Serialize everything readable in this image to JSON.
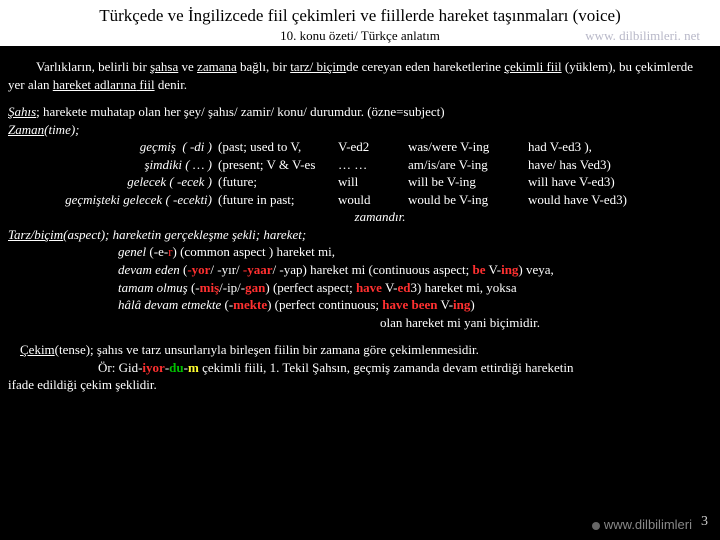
{
  "header": {
    "title": "Türkçede ve İngilizcede fiil çekimleri ve fiillerde hareket taşınmaları (voice)",
    "subtitle": "10. konu özeti/ Türkçe anlatım",
    "url": "www. dilbilimleri. net"
  },
  "intro": {
    "p1a": "Varlıkların, belirli bir ",
    "p1_sahsa": "şahsa",
    "p1_ve": " ve ",
    "p1_zamana": "zamana",
    "p1b": " bağlı, bir ",
    "p1_tarz": "tarz/ biçim",
    "p1c": "de cereyan eden hareketlerine ",
    "p1_cekimli": "çekimli fiil",
    "p1d": " (yüklem), bu çekimlerde yer alan ",
    "p1_hareket": "hareket adlarına",
    "p1_fiil": " fiil",
    "p1e": " denir."
  },
  "sahis": {
    "label": "Şahıs",
    "text": "; harekete muhatap olan her şey/ şahıs/ zamir/ konu/ durumdur. (özne=subject)"
  },
  "zaman": {
    "label": "Zaman",
    "label_suffix": "(time);",
    "rows": [
      {
        "tr": "geçmiş",
        "suffix": "( -di )",
        "en": "(past;",
        "f1": "used to V,",
        "f2": "V-ed2",
        "f3": "was/were V-ing",
        "f4": "had V-ed3 ),"
      },
      {
        "tr": "şimdiki",
        "suffix": "( … )",
        "en": "(present;",
        "f1": "V & V-es",
        "f2": "… …",
        "f3": "am/is/are V-ing",
        "f4": "have/ has Ved3)"
      },
      {
        "tr": "gelecek",
        "suffix": "( -ecek )",
        "en": "(future;",
        "f1": "",
        "f2": "will",
        "f3": "will be V-ing",
        "f4": "will have V-ed3)"
      },
      {
        "tr": "geçmişteki gelecek",
        "suffix": "( -ecekti)",
        "en": "(future in past;",
        "f1": "",
        "f2": "would",
        "f3": "would be V-ing",
        "f4": "would have V-ed3)"
      }
    ],
    "closing": "zamandır."
  },
  "tarz": {
    "label": "Tarz/biçim",
    "label_suffix": "(aspect); hareketin gerçekleşme şekli; hareket;",
    "lines": {
      "genel_a": "genel",
      "genel_b": " (-e-",
      "genel_r": "r",
      "genel_c": ") (common aspect ) hareket mi,",
      "devam_a": "devam eden",
      "devam_b": " (",
      "devam_y1": "-yor",
      "devam_s1": "/ -yır/ ",
      "devam_y2": "-yaar",
      "devam_s2": "/ -yap) hareket mi (continuous aspect; ",
      "devam_be": "be",
      "devam_v": " V-",
      "devam_ing": "ing",
      "devam_end": ") veya,",
      "tamam_a": "tamam olmuş",
      "tamam_b": " (-",
      "tamam_m": "miş",
      "tamam_s1": "/-ip/-",
      "tamam_g": "gan",
      "tamam_s2": ") (perfect aspect; ",
      "tamam_have": "have",
      "tamam_v": " V-",
      "tamam_ed": "ed",
      "tamam_end": "3) hareket mi, yoksa",
      "hala_a": "hâlâ devam etmekte",
      "hala_b": " (-",
      "hala_m": "mekte",
      "hala_s": ") (perfect continuous; ",
      "hala_hb": "have been",
      "hala_v": " V-",
      "hala_ing": "ing",
      "hala_end": ")"
    },
    "closing": "olan hareket mi yani biçimidir."
  },
  "cekim": {
    "label": "Çekim",
    "label_suffix": "(tense); şahıs ve tarz unsurlarıyla birleşen fiilin bir zamana göre çekimlenmesidir.",
    "ornek_pre": "Ör: Gid-",
    "ornek_iyor": "iyor",
    "ornek_dash1": "-",
    "ornek_du": "du",
    "ornek_dash2": "-",
    "ornek_m": "m",
    "ornek_post": " çekimli fiili, 1. Tekil Şahsın, geçmiş zamanda devam ettirdiği hareketin",
    "tail": "ifade edildiği çekim şeklidir."
  },
  "footer": {
    "url": "www.dilbilimleri",
    "page": "3"
  }
}
